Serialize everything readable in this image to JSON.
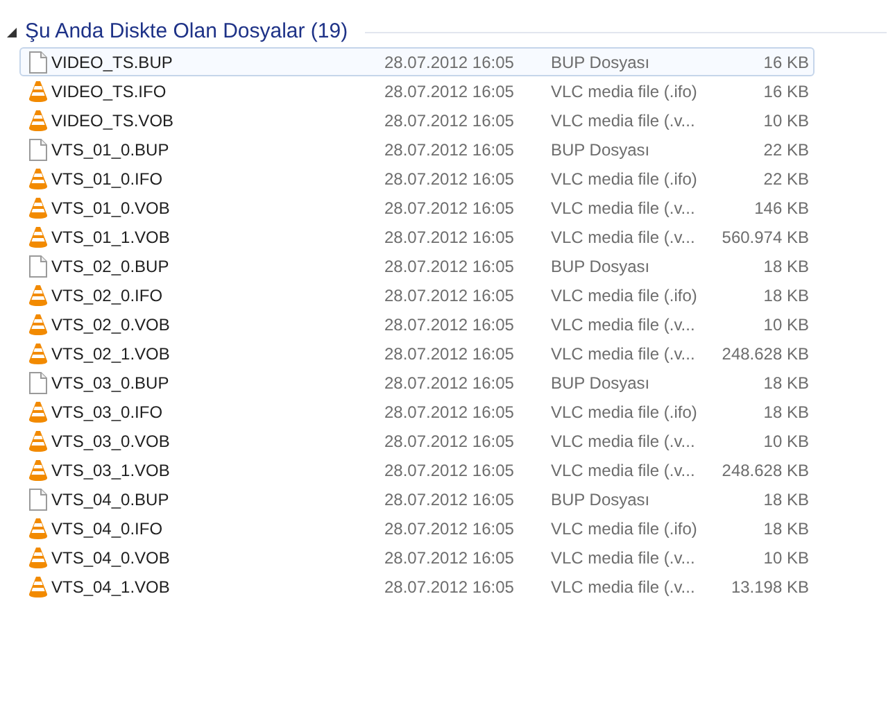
{
  "group": {
    "title": "Şu Anda Diskte Olan Dosyalar (19)",
    "expanded": true
  },
  "files": [
    {
      "name": "VIDEO_TS.BUP",
      "date": "28.07.2012 16:05",
      "type": "BUP Dosyası",
      "size": "16 KB",
      "kind": "document",
      "selected": true
    },
    {
      "name": "VIDEO_TS.IFO",
      "date": "28.07.2012 16:05",
      "type": "VLC media file (.ifo)",
      "size": "16 KB",
      "kind": "vlc",
      "selected": false
    },
    {
      "name": "VIDEO_TS.VOB",
      "date": "28.07.2012 16:05",
      "type": "VLC media file (.v...",
      "size": "10 KB",
      "kind": "vlc",
      "selected": false
    },
    {
      "name": "VTS_01_0.BUP",
      "date": "28.07.2012 16:05",
      "type": "BUP Dosyası",
      "size": "22 KB",
      "kind": "document",
      "selected": false
    },
    {
      "name": "VTS_01_0.IFO",
      "date": "28.07.2012 16:05",
      "type": "VLC media file (.ifo)",
      "size": "22 KB",
      "kind": "vlc",
      "selected": false
    },
    {
      "name": "VTS_01_0.VOB",
      "date": "28.07.2012 16:05",
      "type": "VLC media file (.v...",
      "size": "146 KB",
      "kind": "vlc",
      "selected": false
    },
    {
      "name": "VTS_01_1.VOB",
      "date": "28.07.2012 16:05",
      "type": "VLC media file (.v...",
      "size": "560.974 KB",
      "kind": "vlc",
      "selected": false
    },
    {
      "name": "VTS_02_0.BUP",
      "date": "28.07.2012 16:05",
      "type": "BUP Dosyası",
      "size": "18 KB",
      "kind": "document",
      "selected": false
    },
    {
      "name": "VTS_02_0.IFO",
      "date": "28.07.2012 16:05",
      "type": "VLC media file (.ifo)",
      "size": "18 KB",
      "kind": "vlc",
      "selected": false
    },
    {
      "name": "VTS_02_0.VOB",
      "date": "28.07.2012 16:05",
      "type": "VLC media file (.v...",
      "size": "10 KB",
      "kind": "vlc",
      "selected": false
    },
    {
      "name": "VTS_02_1.VOB",
      "date": "28.07.2012 16:05",
      "type": "VLC media file (.v...",
      "size": "248.628 KB",
      "kind": "vlc",
      "selected": false
    },
    {
      "name": "VTS_03_0.BUP",
      "date": "28.07.2012 16:05",
      "type": "BUP Dosyası",
      "size": "18 KB",
      "kind": "document",
      "selected": false
    },
    {
      "name": "VTS_03_0.IFO",
      "date": "28.07.2012 16:05",
      "type": "VLC media file (.ifo)",
      "size": "18 KB",
      "kind": "vlc",
      "selected": false
    },
    {
      "name": "VTS_03_0.VOB",
      "date": "28.07.2012 16:05",
      "type": "VLC media file (.v...",
      "size": "10 KB",
      "kind": "vlc",
      "selected": false
    },
    {
      "name": "VTS_03_1.VOB",
      "date": "28.07.2012 16:05",
      "type": "VLC media file (.v...",
      "size": "248.628 KB",
      "kind": "vlc",
      "selected": false
    },
    {
      "name": "VTS_04_0.BUP",
      "date": "28.07.2012 16:05",
      "type": "BUP Dosyası",
      "size": "18 KB",
      "kind": "document",
      "selected": false
    },
    {
      "name": "VTS_04_0.IFO",
      "date": "28.07.2012 16:05",
      "type": "VLC media file (.ifo)",
      "size": "18 KB",
      "kind": "vlc",
      "selected": false
    },
    {
      "name": "VTS_04_0.VOB",
      "date": "28.07.2012 16:05",
      "type": "VLC media file (.v...",
      "size": "10 KB",
      "kind": "vlc",
      "selected": false
    },
    {
      "name": "VTS_04_1.VOB",
      "date": "28.07.2012 16:05",
      "type": "VLC media file (.v...",
      "size": "13.198 KB",
      "kind": "vlc",
      "selected": false
    }
  ]
}
